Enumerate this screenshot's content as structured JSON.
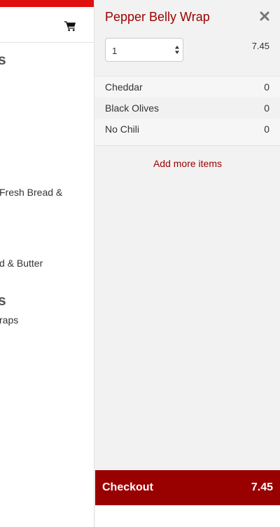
{
  "background_page": {
    "heading_1": "s",
    "text_1": "Fresh Bread &",
    "text_2": "d & Butter",
    "heading_2": "s",
    "text_3": "raps"
  },
  "cart": {
    "item_title": "Pepper Belly Wrap",
    "quantity": "1",
    "item_price": "7.45",
    "modifiers": [
      {
        "name": "Cheddar",
        "count": "0"
      },
      {
        "name": "Black Olives",
        "count": "0"
      },
      {
        "name": "No Chili",
        "count": "0"
      }
    ],
    "add_more_label": "Add more items",
    "checkout_label": "Checkout",
    "checkout_total": "7.45"
  },
  "colors": {
    "accent": "#9b0000",
    "top_bar": "#e0100f",
    "checkout_bg": "#990000"
  },
  "icons": [
    "cart-icon",
    "close-icon",
    "select-arrows-icon"
  ]
}
